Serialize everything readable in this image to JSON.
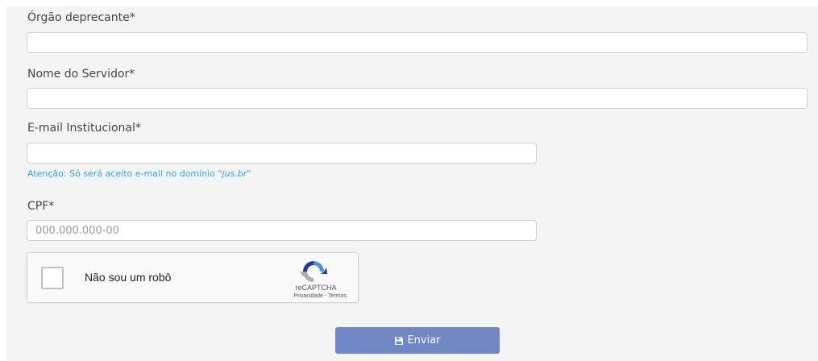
{
  "form": {
    "orgao_label": "Órgão deprecante*",
    "orgao_value": "",
    "nome_label": "Nome do Servidor*",
    "nome_value": "",
    "email_label": "E-mail Institucional*",
    "email_value": "",
    "email_hint_prefix": "Atenção: Só será aceito e-mail no domínio \"",
    "email_hint_domain": "jus.br",
    "email_hint_suffix": "\"",
    "cpf_label": "CPF*",
    "cpf_value": "",
    "cpf_placeholder": "000.000.000-00",
    "submit_label": "Enviar",
    "submit_icon": "floppy-disk-icon",
    "accent_color": "#29a9df",
    "button_color": "#7187c4"
  },
  "recaptcha": {
    "checkbox_label": "Não sou um robô",
    "brand": "reCAPTCHA",
    "privacy_link": "Privacidade",
    "separator": " - ",
    "terms_link": "Termos",
    "checked": false
  }
}
